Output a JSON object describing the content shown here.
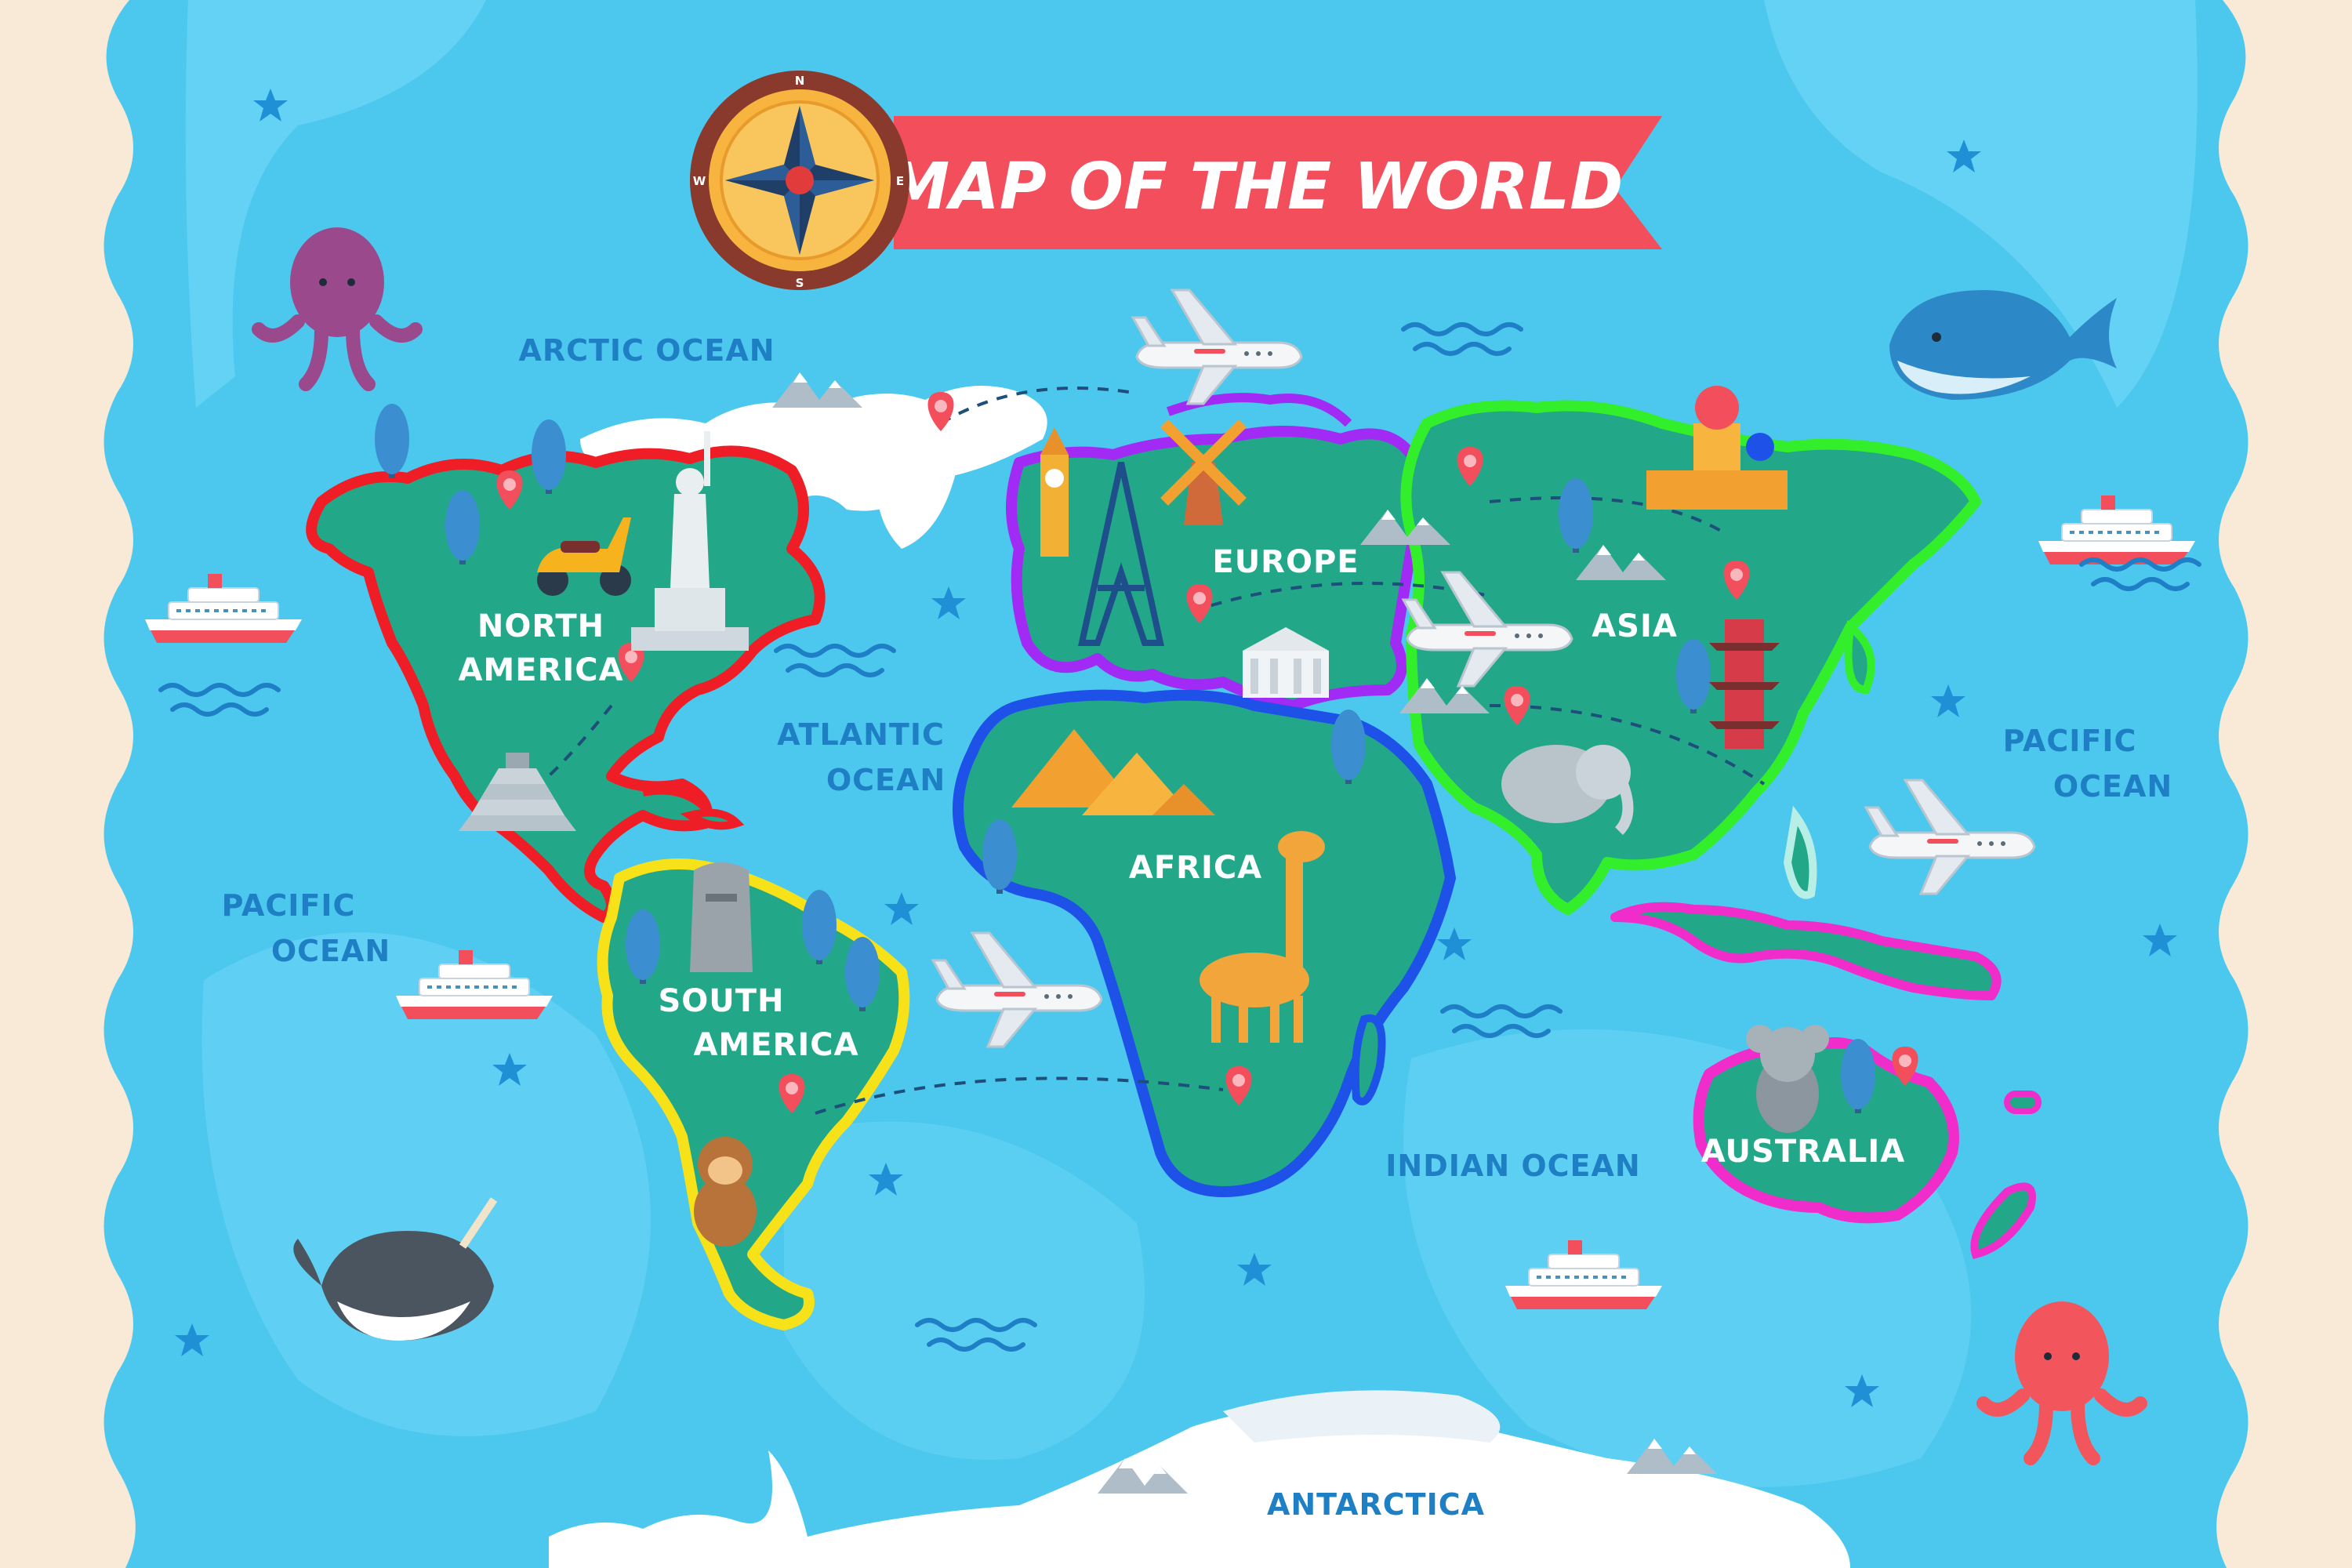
{
  "title": "MAP OF THE WORLD",
  "compass": {
    "n": "N",
    "e": "E",
    "s": "S",
    "w": "W"
  },
  "oceans": {
    "arctic": "ARCTIC OCEAN",
    "atlantic_1": "ATLANTIC",
    "atlantic_2": "OCEAN",
    "pacific_west_1": "PACIFIC",
    "pacific_west_2": "OCEAN",
    "pacific_east_1": "PACIFIC",
    "pacific_east_2": "OCEAN",
    "indian": "INDIAN OCEAN"
  },
  "continents": {
    "north_america_1": "NORTH",
    "north_america_2": "AMERICA",
    "south_america_1": "SOUTH",
    "south_america_2": "AMERICA",
    "europe": "EUROPE",
    "africa": "AFRICA",
    "asia": "ASIA",
    "australia": "AUSTRALIA",
    "antarctica": "ANTARCTICA"
  },
  "colors": {
    "ocean": "#4cc8ee",
    "ocean_light": "#6dd6f6",
    "land": "#22a888",
    "border": "#f8ead6",
    "ribbon": "#f24e5c",
    "north_america_outline": "#ef1d26",
    "south_america_outline": "#f7e21a",
    "europe_outline": "#a12af5",
    "africa_outline": "#1e51e8",
    "asia_outline": "#33ee2a",
    "australia_outline": "#f02ccb"
  }
}
